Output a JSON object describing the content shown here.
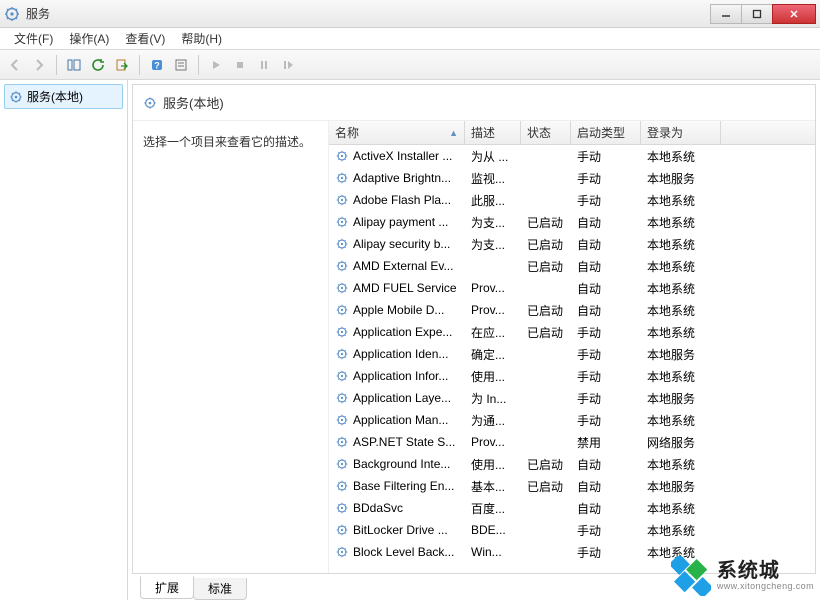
{
  "window": {
    "title": "服务",
    "path_hint": ""
  },
  "menus": {
    "file": "文件(F)",
    "action": "操作(A)",
    "view": "查看(V)",
    "help": "帮助(H)"
  },
  "sidebar": {
    "root_label": "服务(本地)"
  },
  "content": {
    "heading": "服务(本地)",
    "desc_prompt": "选择一个项目来查看它的描述。"
  },
  "columns": {
    "name": "名称",
    "desc": "描述",
    "status": "状态",
    "startup": "启动类型",
    "logon": "登录为"
  },
  "bottom_tabs": {
    "extended": "扩展",
    "standard": "标准"
  },
  "watermark": {
    "brand": "系统城",
    "url": "www.xitongcheng.com"
  },
  "services": [
    {
      "name": "ActiveX Installer ...",
      "desc": "为从 ...",
      "status": "",
      "startup": "手动",
      "logon": "本地系统"
    },
    {
      "name": "Adaptive Brightn...",
      "desc": "监视...",
      "status": "",
      "startup": "手动",
      "logon": "本地服务"
    },
    {
      "name": "Adobe Flash Pla...",
      "desc": "此服...",
      "status": "",
      "startup": "手动",
      "logon": "本地系统"
    },
    {
      "name": "Alipay payment ...",
      "desc": "为支...",
      "status": "已启动",
      "startup": "自动",
      "logon": "本地系统"
    },
    {
      "name": "Alipay security b...",
      "desc": "为支...",
      "status": "已启动",
      "startup": "自动",
      "logon": "本地系统"
    },
    {
      "name": "AMD External Ev...",
      "desc": "",
      "status": "已启动",
      "startup": "自动",
      "logon": "本地系统"
    },
    {
      "name": "AMD FUEL Service",
      "desc": "Prov...",
      "status": "",
      "startup": "自动",
      "logon": "本地系统"
    },
    {
      "name": "Apple Mobile D...",
      "desc": "Prov...",
      "status": "已启动",
      "startup": "自动",
      "logon": "本地系统"
    },
    {
      "name": "Application Expe...",
      "desc": "在应...",
      "status": "已启动",
      "startup": "手动",
      "logon": "本地系统"
    },
    {
      "name": "Application Iden...",
      "desc": "确定...",
      "status": "",
      "startup": "手动",
      "logon": "本地服务"
    },
    {
      "name": "Application Infor...",
      "desc": "使用...",
      "status": "",
      "startup": "手动",
      "logon": "本地系统"
    },
    {
      "name": "Application Laye...",
      "desc": "为 In...",
      "status": "",
      "startup": "手动",
      "logon": "本地服务"
    },
    {
      "name": "Application Man...",
      "desc": "为通...",
      "status": "",
      "startup": "手动",
      "logon": "本地系统"
    },
    {
      "name": "ASP.NET State S...",
      "desc": "Prov...",
      "status": "",
      "startup": "禁用",
      "logon": "网络服务"
    },
    {
      "name": "Background Inte...",
      "desc": "使用...",
      "status": "已启动",
      "startup": "自动",
      "logon": "本地系统"
    },
    {
      "name": "Base Filtering En...",
      "desc": "基本...",
      "status": "已启动",
      "startup": "自动",
      "logon": "本地服务"
    },
    {
      "name": "BDdaSvc",
      "desc": "百度...",
      "status": "",
      "startup": "自动",
      "logon": "本地系统"
    },
    {
      "name": "BitLocker Drive ...",
      "desc": "BDE...",
      "status": "",
      "startup": "手动",
      "logon": "本地系统"
    },
    {
      "name": "Block Level Back...",
      "desc": "Win...",
      "status": "",
      "startup": "手动",
      "logon": "本地系统"
    }
  ]
}
